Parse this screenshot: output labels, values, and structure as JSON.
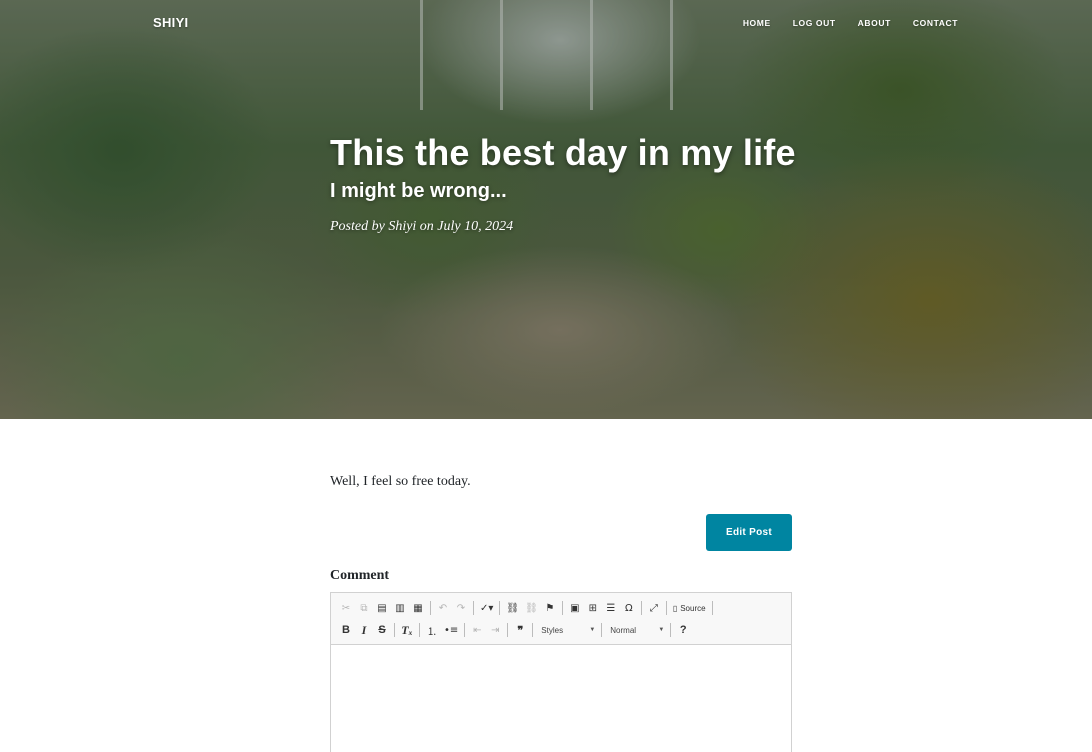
{
  "nav": {
    "brand": "SHIYI",
    "links": [
      "HOME",
      "LOG OUT",
      "ABOUT",
      "CONTACT"
    ]
  },
  "post": {
    "title": "This the best day in my life",
    "subtitle": "I might be wrong...",
    "meta": "Posted by Shiyi on July 10, 2024",
    "body": "Well, I feel so free today."
  },
  "actions": {
    "edit_label": "Edit Post"
  },
  "comment": {
    "label": "Comment",
    "editor": {
      "source_label": "Source",
      "styles_label": "Styles",
      "format_label": "Normal",
      "help_label": "?"
    }
  },
  "colors": {
    "accent": "#0085a1",
    "toolbar_bg": "#f8f8f8"
  }
}
